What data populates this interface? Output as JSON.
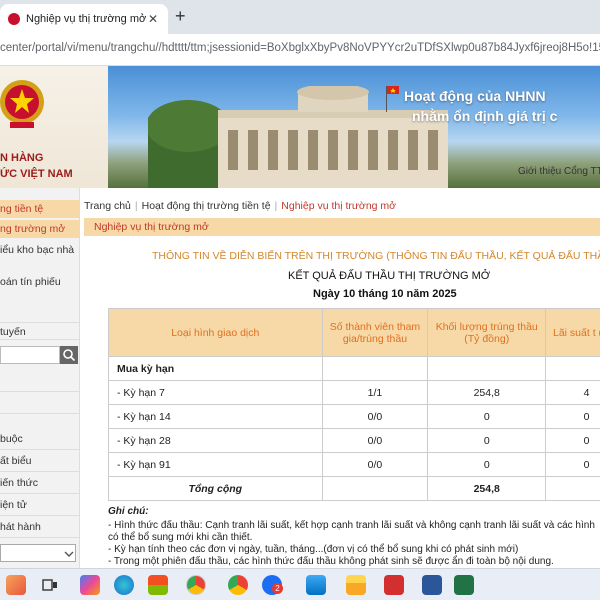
{
  "browser": {
    "tab_title": "Nghiệp vụ thị trường mở",
    "close": "✕",
    "new_tab": "+",
    "url_prefix": "center/portal/vi/menu/trangchu//hdtttt/ttm;jsessionid=BoXbglxXbyPv8NoVPYYcr2uTDfSXlwp0u87b84Jyxf6jreoj8H5o!1524935"
  },
  "header": {
    "bank_line1": "N HÀNG",
    "bank_line2": "ỨC VIỆT NAM",
    "banner_line1": "Hoạt động của NHNN",
    "banner_line2": "nhằm ổn định giá trị c",
    "banner_link": "Giới thiệu Cổng TT"
  },
  "sidebar": {
    "item1": "ng tiền tệ",
    "item2": "ng trường mở",
    "item3": "iểu kho bạc nhà",
    "item4": "oán tín phiếu",
    "item5": "tuyến",
    "rows": [
      "",
      "",
      "buộc",
      "ất biểu",
      "iến thức",
      "iện tử",
      "hát hành"
    ]
  },
  "main": {
    "breadcrumb": [
      "Trang chủ",
      "Hoạt động thị trường tiền tệ",
      "Nghiệp vụ thị trường mở"
    ],
    "section": "Nghiệp vụ thị trường mở",
    "info_title": "THÔNG TIN VỀ DIỄN BIẾN TRÊN THỊ TRƯỜNG (THÔNG TIN ĐẤU THẦU, KẾT QUẢ ĐẤU THẦU",
    "result_title": "KẾT QUẢ ĐẤU THẦU THỊ TRƯỜNG MỞ",
    "date_title": "Ngày 10 tháng 10 năm 2025"
  },
  "table": {
    "headers": [
      "Loại hình giao dịch",
      "Số thành viên tham gia/trúng thầu",
      "Khối lượng trúng thầu (Tỷ đồng)",
      "Lãi suất t (%/n"
    ],
    "group": "Mua kỳ hạn",
    "rows": [
      {
        "label": "- Kỳ hạn 7",
        "members": "1/1",
        "volume": "254,8",
        "rate": "4"
      },
      {
        "label": "- Kỳ hạn 14",
        "members": "0/0",
        "volume": "0",
        "rate": "0"
      },
      {
        "label": "- Kỳ hạn 28",
        "members": "0/0",
        "volume": "0",
        "rate": "0"
      },
      {
        "label": "- Kỳ hạn 91",
        "members": "0/0",
        "volume": "0",
        "rate": "0"
      }
    ],
    "total_label": "Tổng cộng",
    "total_volume": "254,8"
  },
  "notes": {
    "head": "Ghi chú:",
    "line1": "- Hình thức đấu thầu: Cạnh tranh lãi suất, kết hợp cạnh tranh lãi suất và không cạnh tranh lãi suất và các hình",
    "line2": "có thể bổ sung mới khi cần thiết.",
    "line3": "- Kỳ hạn tính theo các đơn vị ngày, tuần, tháng...(đơn vị có thể bổ sung khi có phát sinh mới)",
    "line4": "- Trong một phiên đấu thầu, các hình thức đấu thầu không phát sinh sẽ được ẩn đi toàn bộ nội dung."
  },
  "taskbar": {
    "badge": "2",
    "icons": [
      "start-icon",
      "taskview-icon",
      "copilot-icon",
      "edge-icon",
      "store-icon",
      "chrome-icon",
      "zalo-icon",
      "explorer-icon",
      "acrobat-icon",
      "word-icon",
      "excel-icon"
    ]
  }
}
